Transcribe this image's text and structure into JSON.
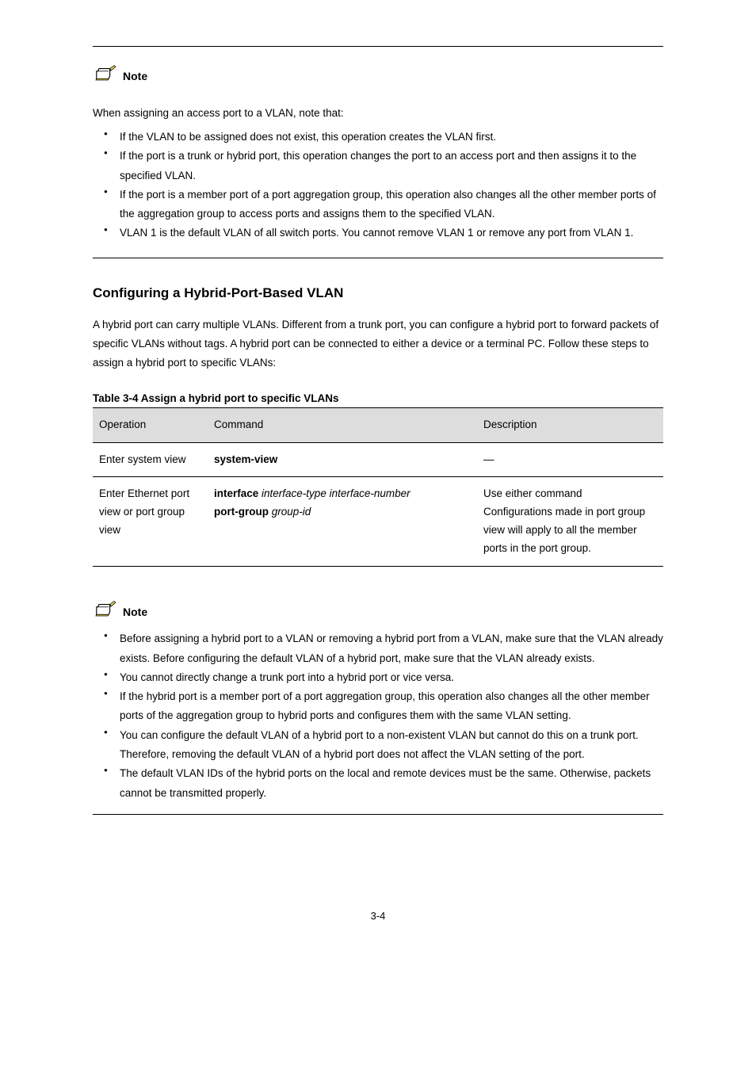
{
  "note_label": "Note",
  "note1": {
    "intro": "When assigning an access port to a VLAN, note that:",
    "items": [
      "If the VLAN to be assigned does not exist, this operation creates the VLAN first.",
      "If the port is a trunk or hybrid port, this operation changes the port to an access port and then assigns it to the specified VLAN.",
      "If the port is a member port of a port aggregation group, this operation also changes all the other member ports of the aggregation group to access ports and assigns them to the specified VLAN.",
      "VLAN 1 is the default VLAN of all switch ports. You cannot remove VLAN 1 or remove any port from VLAN 1."
    ]
  },
  "section_title": "Configuring a Hybrid-Port-Based VLAN",
  "section_body": "A hybrid port can carry multiple VLANs. Different from a trunk port, you can configure a hybrid port to forward packets of specific VLANs without tags. A hybrid port can be connected to either a device or a terminal PC. Follow these steps to assign a hybrid port to specific VLANs:",
  "table_caption": "Table 3-4 Assign a hybrid port to specific VLANs",
  "table": {
    "headers": [
      "Operation",
      "Command",
      "Description"
    ],
    "rows": [
      [
        "Enter system view",
        "system-view",
        "—"
      ],
      [
        "Enter Ethernet port view or port group view",
        "Use either command",
        "Configurations made in port group view will apply to all the member ports in the port group."
      ]
    ],
    "row2_cmd_line1": "interface ",
    "row2_cmd_arg1": "interface-type interface-number",
    "row2_cmd_line2": "port-group ",
    "row2_cmd_arg2": "group-id"
  },
  "note2": {
    "items": [
      "Before assigning a hybrid port to a VLAN or removing a hybrid port from a VLAN, make sure that the VLAN already exists. Before configuring the default VLAN of a hybrid port, make sure that the VLAN already exists.",
      "You cannot directly change a trunk port into a hybrid port or vice versa.",
      "If the hybrid port is a member port of a port aggregation group, this operation also changes all the other member ports of the aggregation group to hybrid ports and configures them with the same VLAN setting.",
      "You can configure the default VLAN of a hybrid port to a non-existent VLAN but cannot do this on a trunk port. Therefore, removing the default VLAN of a hybrid port does not affect the VLAN setting of the port.",
      "The default VLAN IDs of the hybrid ports on the local and remote devices must be the same. Otherwise, packets cannot be transmitted properly."
    ]
  },
  "page_number": "3-4"
}
